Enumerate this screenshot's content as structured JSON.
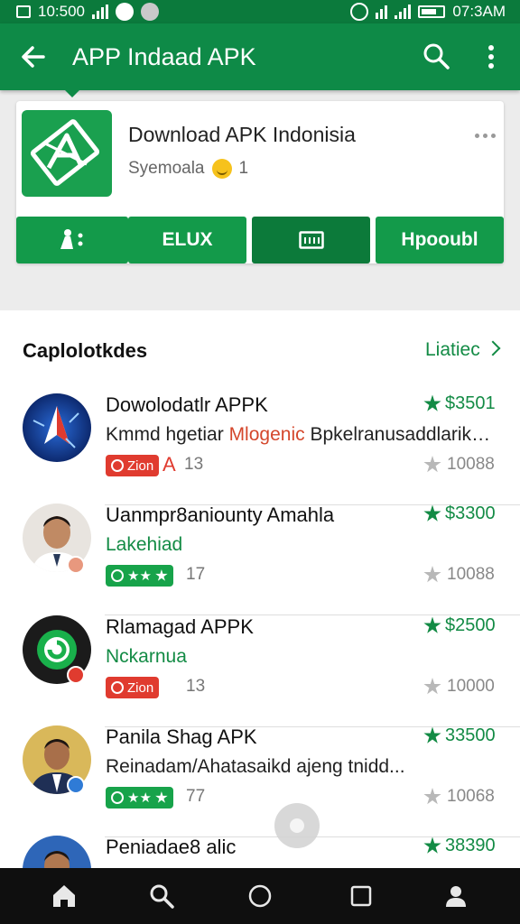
{
  "status_bar": {
    "left_time": "10:500",
    "right_time": "07:3AM"
  },
  "app_bar": {
    "title": "APP Indaad APK",
    "icons": [
      "back-arrow-icon",
      "search-icon",
      "more-vert-icon"
    ]
  },
  "header": {
    "app_name": "Download APK Indonisia",
    "developer": "Syemoala",
    "count": "1",
    "buttons": [
      {
        "label": "",
        "icon": "share-icon"
      },
      {
        "label": "ELUX",
        "icon": ""
      },
      {
        "label": "",
        "icon": "screen-icon"
      },
      {
        "label": "Hpooubl",
        "icon": ""
      }
    ]
  },
  "section": {
    "title": "Caplolotkdes",
    "link": "Liatiec"
  },
  "items": [
    {
      "title": "Dowolodatlr APPK",
      "subtitle": "Kmmd hgetiar",
      "subtitle_highlight": "Mlogenic",
      "subtitle_rest": "Bpkelranusaddlarikal...",
      "tag": "Zion",
      "tag_extra": "A",
      "tag_count": "13",
      "price": "$3501",
      "downloads": "10088",
      "accent": "#e03b2f"
    },
    {
      "title": "Uanmpr8aniounty Amahla",
      "subtitle": "Lakehiad",
      "tag": "★★",
      "tag_extra": "",
      "tag_count": "17",
      "price": "$3300",
      "downloads": "10088",
      "accent": "#17a34a"
    },
    {
      "title": "Rlamagad APPK",
      "subtitle": "Nckarnua",
      "tag": "Zion",
      "tag_extra": "",
      "tag_count": "13",
      "price": "$2500",
      "downloads": "10000",
      "accent": "#e03b2f"
    },
    {
      "title": "Panila Shag APK",
      "subtitle": "Reinadam/Ahatasaikd ajeng tnidd...",
      "tag": "★★",
      "tag_extra": "",
      "tag_count": "77",
      "price": "33500",
      "downloads": "10068",
      "accent": "#17a34a"
    },
    {
      "title": "Peniadae8 alic",
      "subtitle": "",
      "tag": "",
      "tag_extra": "",
      "tag_count": "",
      "price": "38390",
      "downloads": "",
      "accent": ""
    }
  ],
  "nav_bar": [
    "home-icon",
    "search-icon",
    "circle-home-icon",
    "square-recents-icon",
    "person-icon"
  ]
}
